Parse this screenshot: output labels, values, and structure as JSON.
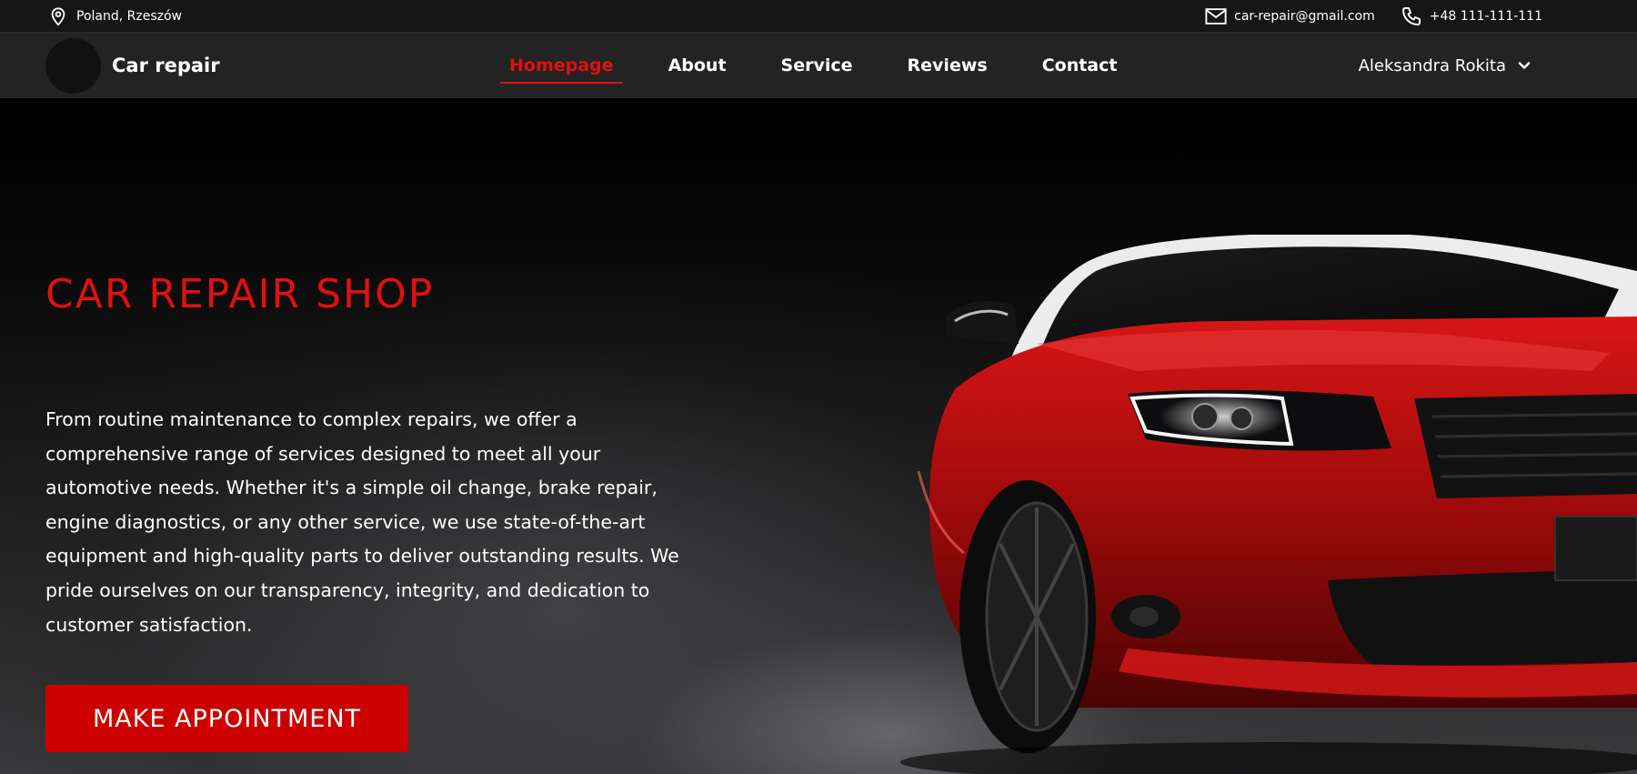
{
  "topbar": {
    "location": "Poland, Rzeszów",
    "email": "car-repair@gmail.com",
    "phone": "+48 111-111-111",
    "icons": {
      "location": "map-pin-icon",
      "email": "envelope-icon",
      "phone": "phone-icon"
    }
  },
  "navbar": {
    "brand": "Car repair",
    "links": [
      {
        "label": "Homepage",
        "active": true
      },
      {
        "label": "About",
        "active": false
      },
      {
        "label": "Service",
        "active": false
      },
      {
        "label": "Reviews",
        "active": false
      },
      {
        "label": "Contact",
        "active": false
      }
    ],
    "user_name": "Aleksandra Rokita"
  },
  "hero": {
    "title": "CAR REPAIR SHOP",
    "description": "From routine maintenance to complex repairs, we offer a comprehensive range of services designed to meet all your automotive needs. Whether it's a simple oil change, brake repair, engine diagnostics, or any other service, we use state-of-the-art equipment and high-quality parts to deliver outstanding results. We pride ourselves on our transparency, integrity, and dedication to customer satisfaction.",
    "cta_label": "MAKE APPOINTMENT"
  },
  "colors": {
    "accent": "#e01010",
    "button": "#cc0000",
    "topbar_bg": "#161616",
    "navbar_bg": "#232323"
  }
}
